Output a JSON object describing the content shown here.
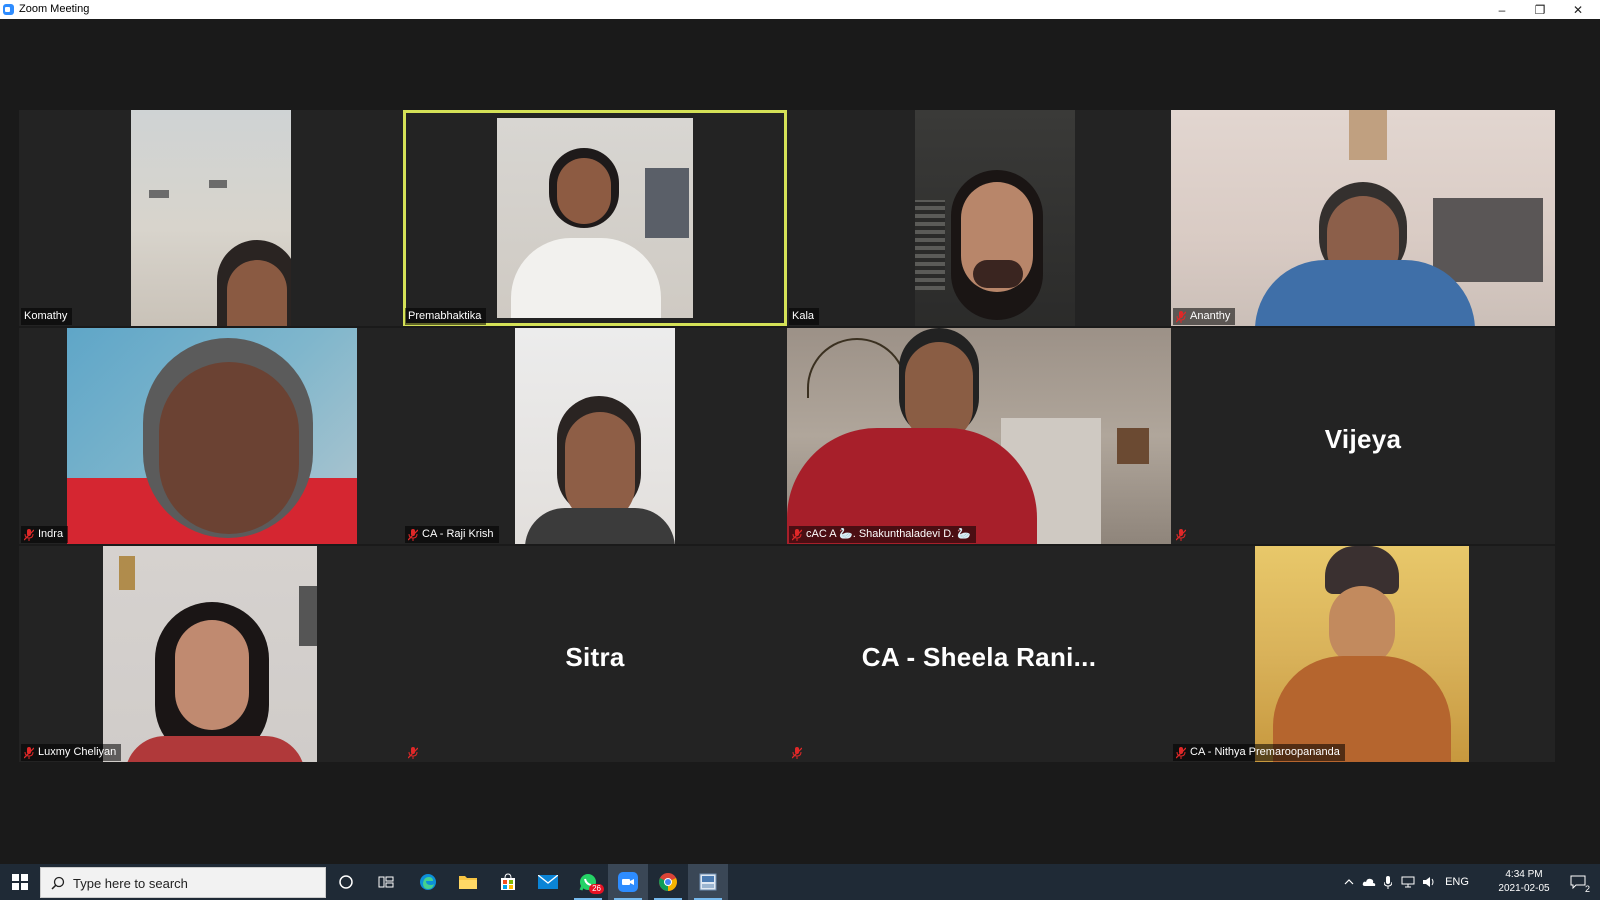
{
  "window": {
    "title": "Zoom Meeting",
    "minimize_glyph": "–",
    "restore_glyph": "❐",
    "close_glyph": "✕"
  },
  "participants": [
    {
      "name": "Komathy",
      "muted": false,
      "video": true
    },
    {
      "name": "Premabhaktika",
      "muted": false,
      "video": true,
      "active_speaker": true
    },
    {
      "name": "Kala",
      "muted": false,
      "video": true
    },
    {
      "name": "Ananthy",
      "muted": true,
      "video": true
    },
    {
      "name": "Indra",
      "muted": true,
      "video": true
    },
    {
      "name": "CA - Raji Krish",
      "muted": true,
      "video": true
    },
    {
      "name": "cAC A 🦢. Shakunthaladevi D. 🦢",
      "muted": true,
      "video": true
    },
    {
      "name": "",
      "big_name": "Vijeya",
      "muted": true,
      "video": false
    },
    {
      "name": "Luxmy Cheliyan",
      "muted": true,
      "video": true
    },
    {
      "name": "",
      "big_name": "Sitra",
      "muted": true,
      "video": false
    },
    {
      "name": "",
      "big_name": "CA - Sheela Rani...",
      "muted": true,
      "video": false
    },
    {
      "name": "CA - Nithya Premaroopananda",
      "muted": true,
      "video": true
    }
  ],
  "taskbar": {
    "search_placeholder": "Type here to search",
    "whatsapp_badge": "26",
    "language": "ENG",
    "time": "4:34 PM",
    "date": "2021-02-05",
    "notification_count": "2"
  },
  "colors": {
    "active_speaker_border": "#d4e157",
    "muted_icon": "#e02828",
    "taskbar_bg": "#1f2a36"
  }
}
